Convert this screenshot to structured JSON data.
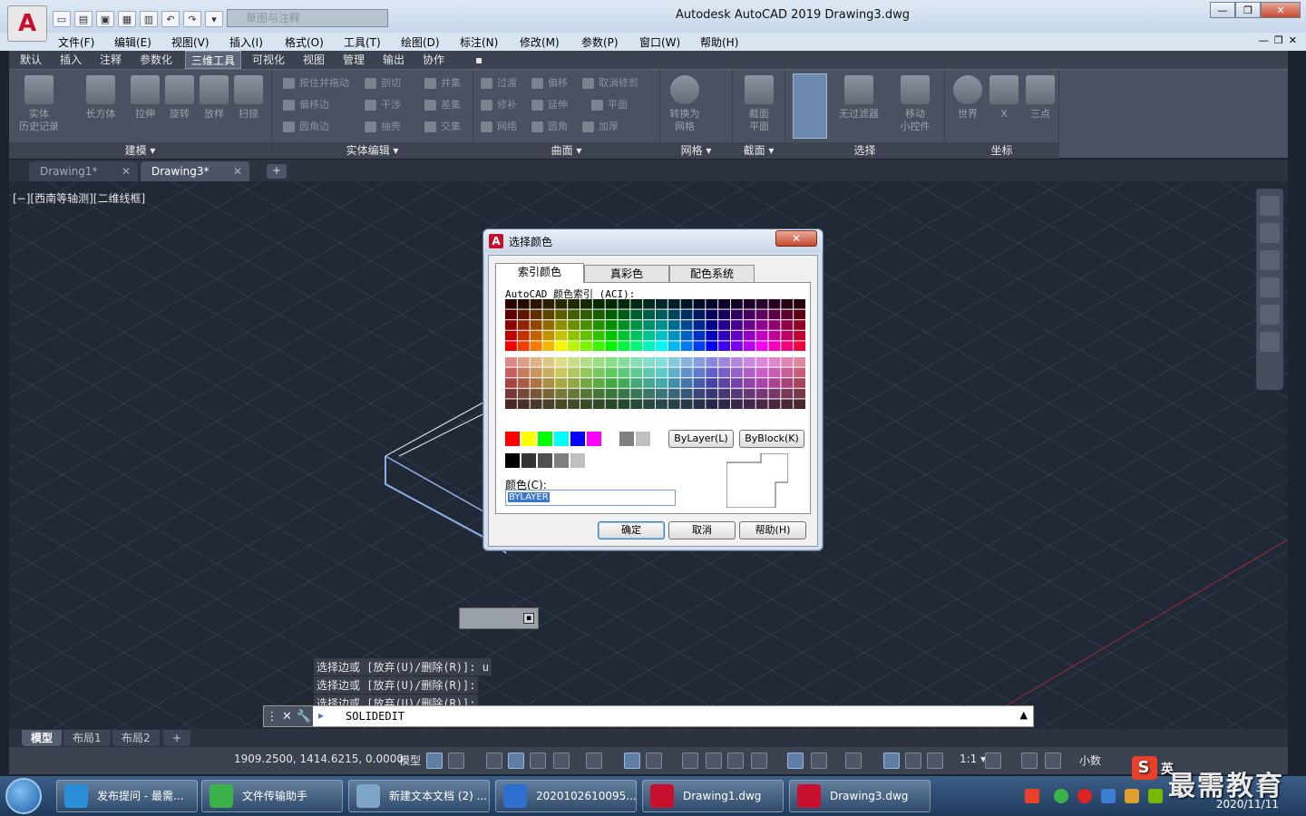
{
  "titlebar": {
    "app_logo": "A",
    "workspace": "草图与注释",
    "window_title": "Autodesk AutoCAD 2019    Drawing3.dwg",
    "minimize": "—",
    "restore": "❐",
    "close": "✕"
  },
  "menu": {
    "items": [
      "文件(F)",
      "编辑(E)",
      "视图(V)",
      "插入(I)",
      "格式(O)",
      "工具(T)",
      "绘图(D)",
      "标注(N)",
      "修改(M)",
      "参数(P)",
      "窗口(W)",
      "帮助(H)"
    ],
    "controls": [
      "—",
      "❐",
      "✕"
    ]
  },
  "ribbon_tabs": [
    "默认",
    "插入",
    "注释",
    "参数化",
    "三维工具",
    "可视化",
    "视图",
    "管理",
    "输出",
    "协作"
  ],
  "ribbon_tab_extra": "▪",
  "ribbon": {
    "panels": [
      "建模 ▾",
      "实体编辑 ▾",
      "曲面 ▾",
      "网格 ▾",
      "截面 ▾",
      "选择",
      "坐标"
    ],
    "modeling": [
      "实体\n历史记录",
      "长方体",
      "拉伸",
      "旋转",
      "放样",
      "扫掠"
    ],
    "solid_edit": [
      "按住并拖动",
      "剖切",
      "并集",
      "偏移边",
      "干涉",
      "差集",
      "圆角边",
      "抽壳",
      "交集"
    ],
    "surface": [
      "过渡",
      "偏移",
      "取消修剪",
      "修补",
      "延伸",
      "平面",
      "网络",
      "圆角",
      "加厚"
    ],
    "mesh": [
      "转换为\n网格"
    ],
    "section": [
      "截面\n平面"
    ],
    "selection": [
      "无过滤器",
      "移动\n小控件"
    ],
    "ucs": [
      "世界",
      "X",
      "三点"
    ]
  },
  "doc_tabs": [
    {
      "label": "Drawing1*",
      "close": "✕"
    },
    {
      "label": "Drawing3*",
      "close": "✕"
    }
  ],
  "doc_tab_add": "+",
  "viewport_label": "[−][西南等轴测][二维线框]",
  "command_history": [
    "选择边或 [放弃(U)/删除(R)]: u",
    "选择边或 [放弃(U)/删除(R)]:",
    "选择边或 [放弃(U)/删除(R)]:"
  ],
  "command_line": {
    "text": "SOLIDEDIT",
    "close": "✕",
    "settings": "🔧",
    "arrow": "▲"
  },
  "layout_tabs": [
    "模型",
    "布局1",
    "布局2"
  ],
  "layout_tab_add": "+",
  "status": {
    "coords": "1909.2500, 1414.6215, 0.0000",
    "model": "模型",
    "scale": "1:1 ▾",
    "units": "小数"
  },
  "dialog": {
    "title": "选择颜色",
    "close": "✕",
    "tabs": [
      "索引颜色",
      "真彩色",
      "配色系统"
    ],
    "aci_label": "AutoCAD 颜色索引 (ACI):",
    "bylayer_button": "ByLayer(L)",
    "byblock_button": "ByBlock(K)",
    "color_label": "颜色(C):",
    "color_value": "BYLAYER",
    "ok": "确定",
    "cancel": "取消",
    "help": "帮助(H)"
  },
  "taskbar": {
    "items": [
      "发布提问 - 最需...",
      "文件传输助手",
      "新建文本文档 (2) ...",
      "2020102610095...",
      "Drawing1.dwg",
      "Drawing3.dwg"
    ],
    "date": "2020/11/11",
    "time_partial": "3"
  },
  "watermark": {
    "brand_text": "最需教育",
    "logo_letter": "S",
    "logo_suffix": "英"
  },
  "colors": {
    "canvas_bg": "#212836",
    "accent": "#5b7fb0",
    "bylayer_highlight": "#3a77d2"
  }
}
